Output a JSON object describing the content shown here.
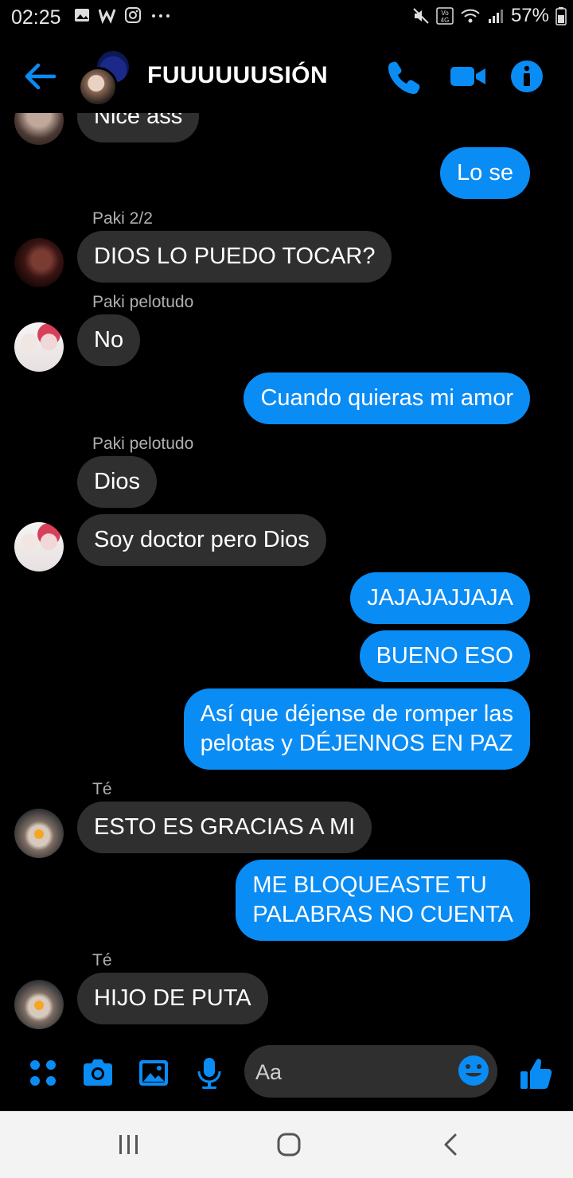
{
  "status_bar": {
    "time": "02:25",
    "battery": "57%",
    "left_icons": [
      "gallery-icon",
      "w-app-icon",
      "instagram-icon",
      "more-dots-icon"
    ],
    "right_icons": [
      "mute-icon",
      "volte-4g-icon",
      "wifi-icon",
      "signal-icon",
      "battery-icon"
    ]
  },
  "header": {
    "title": "FUUUUUUSIÓN",
    "actions": [
      "phone-icon",
      "video-camera-icon",
      "info-icon"
    ]
  },
  "colors": {
    "accent": "#0a8cf5",
    "incoming_bubble": "#2f2f2f",
    "background": "#000000"
  },
  "messages": [
    {
      "dir": "in",
      "text": "Nice ass",
      "avatar": "partial"
    },
    {
      "dir": "out",
      "text": "Lo se"
    },
    {
      "dir": "in",
      "sender": "Paki 2/2",
      "text": "DIOS LO PUEDO TOCAR?",
      "avatar": "paki"
    },
    {
      "dir": "in",
      "sender": "Paki pelotudo",
      "text": "No",
      "avatar": "duo"
    },
    {
      "dir": "out",
      "text": "Cuando quieras mi amor"
    },
    {
      "dir": "in",
      "sender": "Paki pelotudo",
      "text": "Dios"
    },
    {
      "dir": "in",
      "text": "Soy doctor pero Dios",
      "avatar": "duo"
    },
    {
      "dir": "out",
      "text": "JAJAJAJJAJA"
    },
    {
      "dir": "out",
      "text": "BUENO ESO"
    },
    {
      "dir": "out",
      "text_lines": [
        "Así que déjense de romper las",
        "pelotas y DÉJENNOS EN PAZ"
      ]
    },
    {
      "dir": "in",
      "sender": "Té",
      "text": "ESTO ES GRACIAS A MI",
      "avatar": "te"
    },
    {
      "dir": "out",
      "text_lines": [
        "ME BLOQUEASTE TU",
        "PALABRAS NO CUENTA"
      ]
    },
    {
      "dir": "in",
      "sender": "Té",
      "text": "HIJO DE PUTA",
      "avatar": "te"
    }
  ],
  "composer": {
    "placeholder": "Aa",
    "icons": [
      "apps-grid-icon",
      "camera-icon",
      "image-icon",
      "microphone-icon",
      "emoji-icon",
      "thumbs-up-icon"
    ]
  },
  "nav_bar": [
    "recents-icon",
    "home-icon",
    "back-nav-icon"
  ]
}
